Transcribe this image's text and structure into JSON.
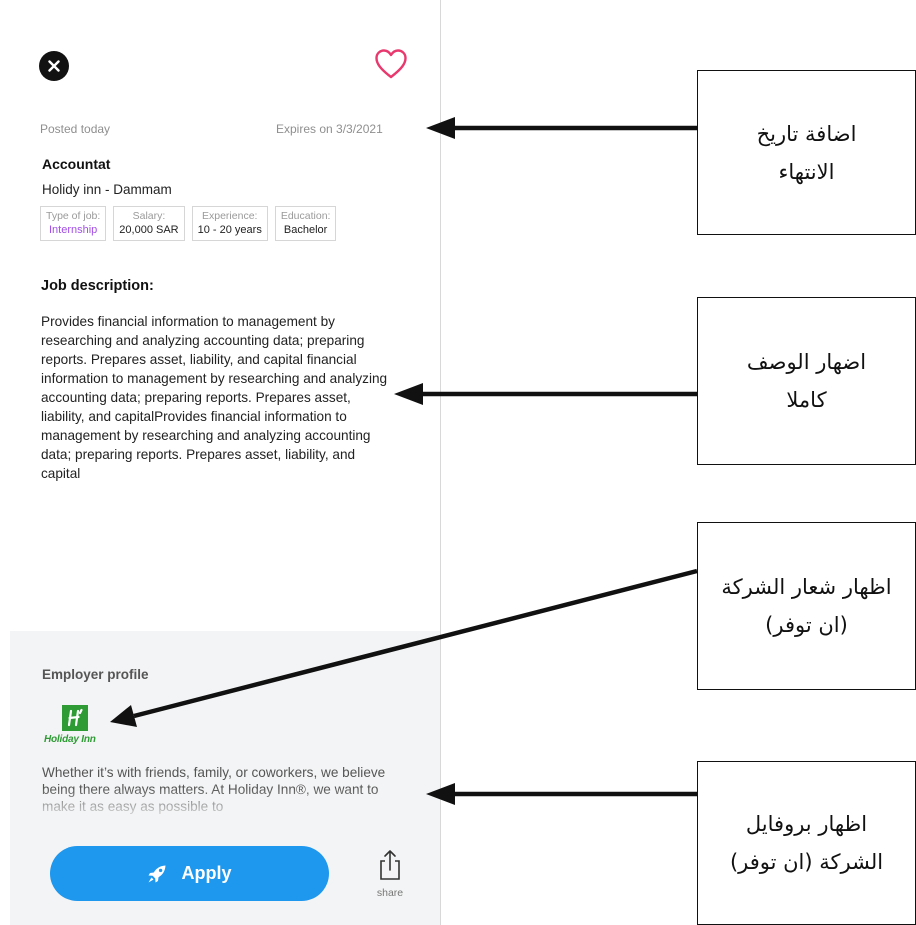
{
  "job": {
    "posted": "Posted today",
    "expires": "Expires on 3/3/2021",
    "title": "Accountat",
    "company": "Holidy inn - Dammam",
    "chips": [
      {
        "label": "Type of job:",
        "value": "Internship"
      },
      {
        "label": "Salary:",
        "value": "20,000 SAR"
      },
      {
        "label": "Experience:",
        "value": "10 - 20 years"
      },
      {
        "label": "Education:",
        "value": "Bachelor"
      }
    ],
    "description_heading": "Job description:",
    "description": "Provides financial information to management by researching and analyzing accounting data; preparing reports. Prepares asset, liability, and capital financial information to management by researching and analyzing accounting data; preparing reports. Prepares asset, liability, and capitalProvides financial information to management by researching and analyzing accounting data; preparing reports. Prepares asset, liability, and capital"
  },
  "employer": {
    "heading": "Employer profile",
    "logo_text": "Holiday Inn",
    "about": "Whether it’s with friends, family, or coworkers, we believe being there always matters. At Holiday Inn®, we want to make it as easy as possible to"
  },
  "actions": {
    "apply_label": "Apply",
    "share_label": "share"
  },
  "annotations": [
    "اضافة تاريخ الانتهاء",
    "اضهار الوصف كاملا",
    "اظهار شعار الشركة (ان توفر)",
    "اظهار بروفايل الشركة (ان توفر)"
  ],
  "colors": {
    "accent_blue": "#1e97ee",
    "heart": "#e8386d",
    "internship_purple": "#a34ee8",
    "brand_green": "#2e9b35"
  },
  "icons": [
    "close-icon",
    "heart-icon",
    "rocket-icon",
    "share-icon"
  ]
}
